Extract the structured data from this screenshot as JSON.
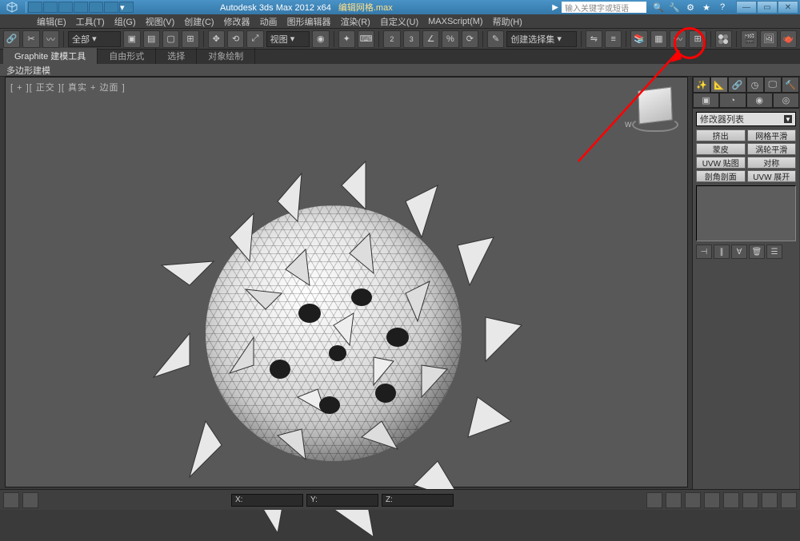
{
  "title": {
    "app": "Autodesk 3ds Max  2012 x64",
    "filename": "编辑网格.max",
    "search_placeholder": "输入关键字或短语"
  },
  "menus": [
    "编辑(E)",
    "工具(T)",
    "组(G)",
    "视图(V)",
    "创建(C)",
    "修改器",
    "动画",
    "图形编辑器",
    "渲染(R)",
    "自定义(U)",
    "MAXScript(M)",
    "帮助(H)"
  ],
  "toolbar": {
    "selection_set": "全部",
    "view_label": "视图",
    "named_sel": "创建选择集"
  },
  "ribbon": {
    "tabs": [
      "Graphite 建模工具",
      "自由形式",
      "选择",
      "对象绘制"
    ],
    "polybar": "多边形建模"
  },
  "viewport": {
    "label": "[ + ][ 正交 ][ 真实 + 边面 ]",
    "compass": "W"
  },
  "panel": {
    "mod_list": "修改器列表",
    "buttons": [
      [
        "挤出",
        "网格平滑"
      ],
      [
        "蒙皮",
        "涡轮平滑"
      ],
      [
        "UVW 贴图",
        "对称"
      ],
      [
        "剖角剖面",
        "UVW 展开"
      ]
    ]
  },
  "status": {
    "x": "X:",
    "y": "Y:",
    "z": "Z:"
  }
}
